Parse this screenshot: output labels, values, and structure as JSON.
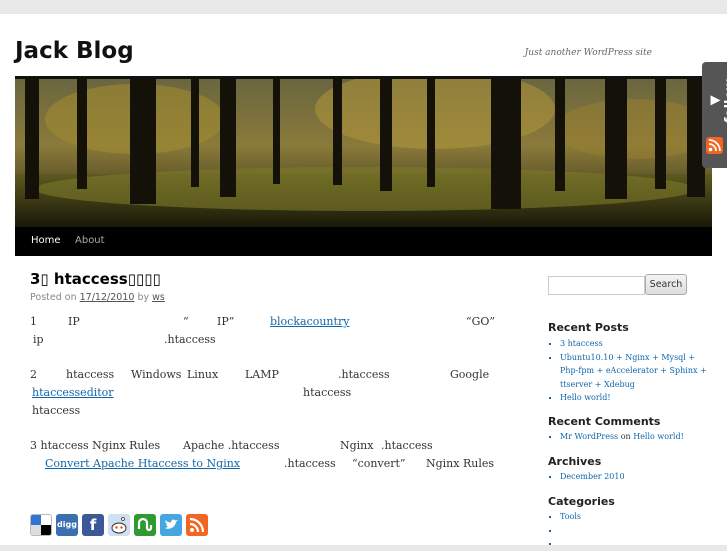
{
  "site": {
    "title": "Jack Blog",
    "description": "Just another WordPress site"
  },
  "nav": {
    "items": [
      "Home",
      "About"
    ]
  },
  "follow": {
    "label": "follow"
  },
  "post": {
    "title": "3▯ htaccess▯▯▯▯",
    "meta": {
      "posted_on": "Posted on",
      "date": "17/12/2010",
      "by": "by",
      "author": "ws"
    },
    "p1": {
      "l1_a": "1",
      "l1_b": "IP",
      "l1_c": "“",
      "l1_d": "IP”",
      "l1_link": "blockacountry",
      "l1_e": "“GO”",
      "l2_a": "ip",
      "l2_b": ".htaccess"
    },
    "p2": {
      "l1_a": "2",
      "l1_b": "htaccess",
      "l1_c": "Windows",
      "l1_d": "Linux",
      "l1_e": "LAMP",
      "l1_f": ".htaccess",
      "l1_g": "Google",
      "l2_link": "htaccesseditor",
      "l2_b": "htaccess",
      "l3_a": "htaccess"
    },
    "p3": {
      "l1_a": "3 htaccess Nginx Rules",
      "l1_b": "Apache .htaccess",
      "l1_c": "Nginx",
      "l1_d": ".htaccess",
      "l2_link": "Convert Apache Htaccess to Nginx",
      "l2_b": ".htaccess",
      "l2_c": "“convert”",
      "l2_d": "Nginx Rules"
    }
  },
  "share_icons": [
    "delicious-icon",
    "digg-icon",
    "facebook-icon",
    "reddit-icon",
    "stumbleupon-icon",
    "twitter-icon",
    "rss-icon"
  ],
  "share_labels": {
    "digg": "digg",
    "facebook": "f"
  },
  "sidebar": {
    "search_button": "Search",
    "recent_posts": {
      "title": "Recent Posts",
      "items": [
        "3 htaccess",
        "Ubuntu10.10 + Nginx + Mysql + Php-fpm + eAccelerator + Sphinx + ttserver + Xdebug",
        "Hello world!"
      ]
    },
    "recent_comments": {
      "title": "Recent Comments",
      "author": "Mr WordPress",
      "on": "on",
      "post": "Hello world!"
    },
    "archives": {
      "title": "Archives",
      "items": [
        "December 2010"
      ]
    },
    "categories": {
      "title": "Categories",
      "items": [
        "Tools"
      ]
    }
  },
  "colors": {
    "link": "#1166aa",
    "nav_bg": "#000000",
    "rss": "#f26522"
  }
}
